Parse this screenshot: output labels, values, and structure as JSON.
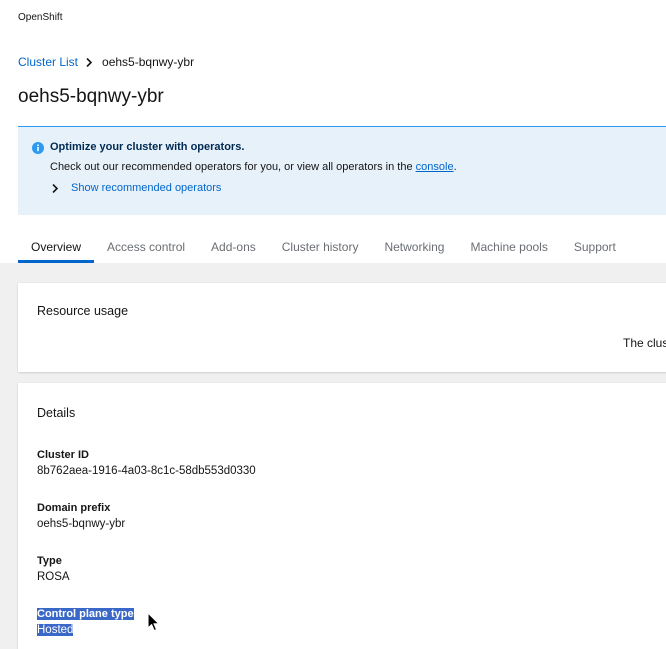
{
  "app": {
    "brand": "OpenShift"
  },
  "breadcrumb": {
    "parent": "Cluster List",
    "current": "oehs5-bqnwy-ybr"
  },
  "page": {
    "title": "oehs5-bqnwy-ybr"
  },
  "alert": {
    "icon": "info-circle-icon",
    "title": "Optimize your cluster with operators.",
    "body_prefix": "Check out our recommended operators for you, or view all operators in the",
    "link": "console",
    "body_suffix": ".",
    "expand_label": "Show recommended operators"
  },
  "tabs": [
    {
      "label": "Overview",
      "active": true
    },
    {
      "label": "Access control",
      "active": false
    },
    {
      "label": "Add-ons",
      "active": false
    },
    {
      "label": "Cluster history",
      "active": false
    },
    {
      "label": "Networking",
      "active": false
    },
    {
      "label": "Machine pools",
      "active": false
    },
    {
      "label": "Support",
      "active": false
    }
  ],
  "resource_usage": {
    "title": "Resource usage",
    "note": "The clus"
  },
  "details": {
    "title": "Details",
    "items": [
      {
        "term": "Cluster ID",
        "value": "8b762aea-1916-4a03-8c1c-58db553d0330"
      },
      {
        "term": "Domain prefix",
        "value": "oehs5-bqnwy-ybr"
      },
      {
        "term": "Type",
        "value": "ROSA"
      },
      {
        "term": "Control plane type",
        "value": "Hosted",
        "selected": true
      }
    ]
  },
  "colors": {
    "link": "#0066cc",
    "alert_bg": "#e7f1fa",
    "alert_accent": "#2b9af3",
    "selection": "#3a68c9",
    "content_bg": "#f0f0f0"
  }
}
